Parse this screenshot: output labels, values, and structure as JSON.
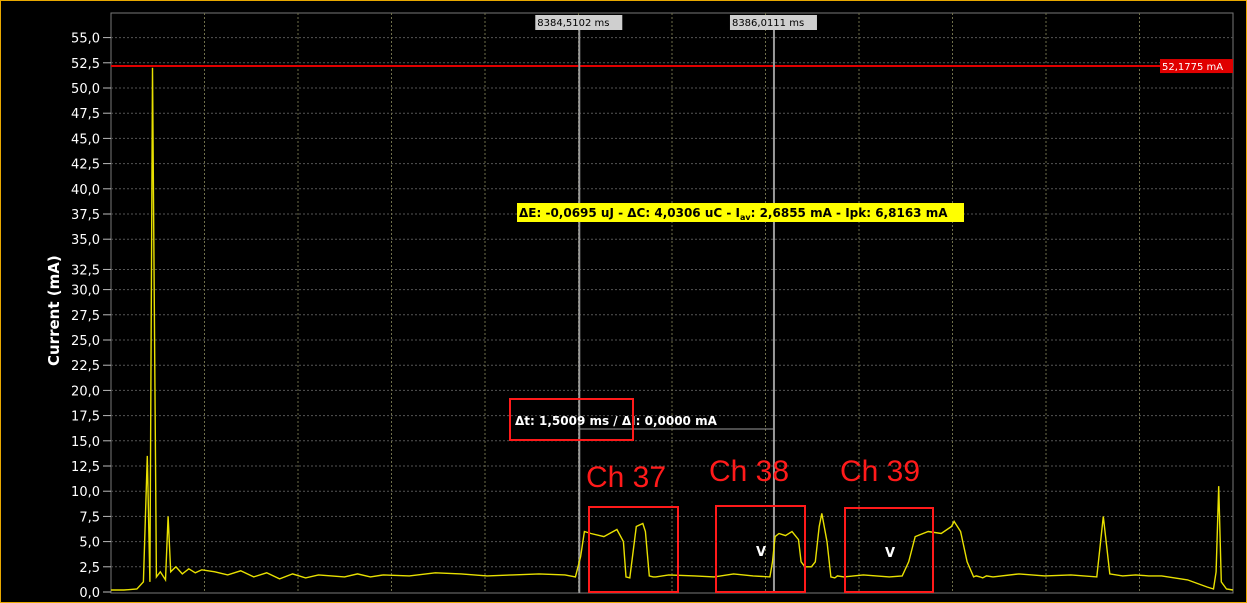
{
  "chart_data": {
    "type": "line",
    "title": "",
    "xlabel": "",
    "ylabel": "Current (mA)",
    "ylim": [
      0,
      57.5
    ],
    "yticks": [
      "0,0",
      "2,5",
      "5,0",
      "7,5",
      "10,0",
      "12,5",
      "15,0",
      "17,5",
      "20,0",
      "22,5",
      "25,0",
      "27,5",
      "30,0",
      "32,5",
      "35,0",
      "37,5",
      "40,0",
      "42,5",
      "45,0",
      "47,5",
      "50,0",
      "52,5",
      "55,0"
    ],
    "ytick_values": [
      0,
      2.5,
      5,
      7.5,
      10,
      12.5,
      15,
      17.5,
      20,
      22.5,
      25,
      27.5,
      30,
      32,
      35,
      37.5,
      40,
      42.5,
      45,
      47.5,
      50,
      52.5,
      55
    ],
    "x_range_ms": [
      8380.9,
      8389.55
    ],
    "grid": true,
    "series": [
      {
        "color": "#e8e000",
        "x": [
          8380.9,
          8381.0,
          8381.1,
          8381.15,
          8381.18,
          8381.2,
          8381.22,
          8381.25,
          8381.28,
          8381.32,
          8381.34,
          8381.36,
          8381.4,
          8381.45,
          8381.5,
          8381.55,
          8381.6,
          8381.7,
          8381.8,
          8381.9,
          8382.0,
          8382.1,
          8382.2,
          8382.3,
          8382.4,
          8382.5,
          8382.6,
          8382.7,
          8382.8,
          8382.9,
          8383.0,
          8383.2,
          8383.4,
          8383.6,
          8383.8,
          8384.0,
          8384.2,
          8384.4,
          8384.48,
          8384.52,
          8384.55,
          8384.6,
          8384.7,
          8384.8,
          8384.85,
          8384.87,
          8384.9,
          8384.95,
          8385.0,
          8385.02,
          8385.05,
          8385.08,
          8385.1,
          8385.2,
          8385.4,
          8385.55,
          8385.7,
          8385.85,
          8385.98,
          8386.0,
          8386.02,
          8386.05,
          8386.1,
          8386.15,
          8386.2,
          8386.22,
          8386.25,
          8386.3,
          8386.33,
          8386.36,
          8386.38,
          8386.42,
          8386.45,
          8386.48,
          8386.5,
          8386.55,
          8386.7,
          8386.9,
          8387.0,
          8387.05,
          8387.1,
          8387.2,
          8387.3,
          8387.38,
          8387.4,
          8387.45,
          8387.5,
          8387.55,
          8387.57,
          8387.6,
          8387.62,
          8387.65,
          8387.7,
          8387.9,
          8388.1,
          8388.3,
          8388.5,
          8388.55,
          8388.6,
          8388.7,
          8388.8,
          8388.9,
          8389.0,
          8389.2,
          8389.35,
          8389.4,
          8389.42,
          8389.44,
          8389.46,
          8389.5,
          8389.55
        ],
        "y": [
          0.2,
          0.2,
          0.3,
          1.0,
          13.5,
          1.0,
          52.0,
          1.5,
          2.0,
          1.2,
          7.5,
          2.0,
          2.5,
          1.8,
          2.3,
          1.9,
          2.2,
          2.0,
          1.7,
          2.1,
          1.5,
          1.9,
          1.3,
          1.8,
          1.4,
          1.7,
          1.6,
          1.5,
          1.8,
          1.5,
          1.7,
          1.6,
          1.9,
          1.8,
          1.6,
          1.7,
          1.8,
          1.7,
          1.5,
          3.5,
          6.0,
          5.8,
          5.5,
          6.2,
          5.0,
          1.5,
          1.4,
          6.5,
          6.8,
          6.0,
          1.6,
          1.5,
          1.5,
          1.7,
          1.6,
          1.5,
          1.8,
          1.6,
          1.5,
          3.0,
          5.5,
          5.8,
          5.6,
          6.0,
          5.2,
          3.0,
          2.5,
          2.5,
          3.0,
          6.5,
          7.8,
          5.0,
          1.5,
          1.4,
          1.6,
          1.5,
          1.7,
          1.5,
          1.6,
          3.0,
          5.5,
          6.0,
          5.8,
          6.5,
          7.0,
          6.0,
          3.0,
          1.5,
          1.6,
          1.5,
          1.4,
          1.6,
          1.5,
          1.8,
          1.6,
          1.7,
          1.5,
          7.5,
          1.8,
          1.6,
          1.7,
          1.6,
          1.6,
          1.2,
          0.5,
          0.3,
          2.0,
          10.5,
          1.0,
          0.3,
          0.2
        ]
      }
    ]
  },
  "threshold": {
    "label": "52,1775 mA",
    "color": "#e00000"
  },
  "cursors": {
    "left_label": "8384,5102 ms",
    "right_label": "8386,0111 ms"
  },
  "measurement": "ΔE: -0,0695 uJ - ΔC: 4,0306 uC - I",
  "measurement_sub": "av",
  "measurement_tail": ": 2,6855 mA - Ipk: 6,8163 mA",
  "delta": "Δt: 1,5009 ms / ΔI: 0,0000 mA",
  "annotations": [
    {
      "label": "Ch 37"
    },
    {
      "label": "Ch 38"
    },
    {
      "label": "Ch 39"
    }
  ],
  "markers": [
    "V",
    "V"
  ],
  "colors": {
    "trace": "#e8e000",
    "annotation": "#ff1a1a",
    "frame": "#e8a800",
    "grid_h": "#555555",
    "grid_v": "#6e6e4a"
  }
}
